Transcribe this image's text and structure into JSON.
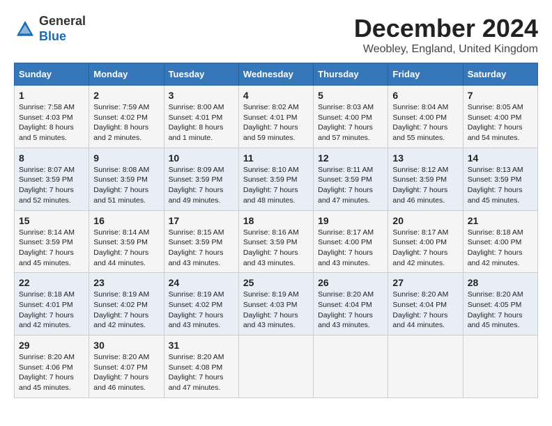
{
  "header": {
    "logo_general": "General",
    "logo_blue": "Blue",
    "title": "December 2024",
    "subtitle": "Weobley, England, United Kingdom"
  },
  "calendar": {
    "days_of_week": [
      "Sunday",
      "Monday",
      "Tuesday",
      "Wednesday",
      "Thursday",
      "Friday",
      "Saturday"
    ],
    "weeks": [
      [
        {
          "day": "1",
          "sunrise": "7:58 AM",
          "sunset": "4:03 PM",
          "daylight": "8 hours and 5 minutes."
        },
        {
          "day": "2",
          "sunrise": "7:59 AM",
          "sunset": "4:02 PM",
          "daylight": "8 hours and 2 minutes."
        },
        {
          "day": "3",
          "sunrise": "8:00 AM",
          "sunset": "4:01 PM",
          "daylight": "8 hours and 1 minute."
        },
        {
          "day": "4",
          "sunrise": "8:02 AM",
          "sunset": "4:01 PM",
          "daylight": "7 hours and 59 minutes."
        },
        {
          "day": "5",
          "sunrise": "8:03 AM",
          "sunset": "4:00 PM",
          "daylight": "7 hours and 57 minutes."
        },
        {
          "day": "6",
          "sunrise": "8:04 AM",
          "sunset": "4:00 PM",
          "daylight": "7 hours and 55 minutes."
        },
        {
          "day": "7",
          "sunrise": "8:05 AM",
          "sunset": "4:00 PM",
          "daylight": "7 hours and 54 minutes."
        }
      ],
      [
        {
          "day": "8",
          "sunrise": "8:07 AM",
          "sunset": "3:59 PM",
          "daylight": "7 hours and 52 minutes."
        },
        {
          "day": "9",
          "sunrise": "8:08 AM",
          "sunset": "3:59 PM",
          "daylight": "7 hours and 51 minutes."
        },
        {
          "day": "10",
          "sunrise": "8:09 AM",
          "sunset": "3:59 PM",
          "daylight": "7 hours and 49 minutes."
        },
        {
          "day": "11",
          "sunrise": "8:10 AM",
          "sunset": "3:59 PM",
          "daylight": "7 hours and 48 minutes."
        },
        {
          "day": "12",
          "sunrise": "8:11 AM",
          "sunset": "3:59 PM",
          "daylight": "7 hours and 47 minutes."
        },
        {
          "day": "13",
          "sunrise": "8:12 AM",
          "sunset": "3:59 PM",
          "daylight": "7 hours and 46 minutes."
        },
        {
          "day": "14",
          "sunrise": "8:13 AM",
          "sunset": "3:59 PM",
          "daylight": "7 hours and 45 minutes."
        }
      ],
      [
        {
          "day": "15",
          "sunrise": "8:14 AM",
          "sunset": "3:59 PM",
          "daylight": "7 hours and 45 minutes."
        },
        {
          "day": "16",
          "sunrise": "8:14 AM",
          "sunset": "3:59 PM",
          "daylight": "7 hours and 44 minutes."
        },
        {
          "day": "17",
          "sunrise": "8:15 AM",
          "sunset": "3:59 PM",
          "daylight": "7 hours and 43 minutes."
        },
        {
          "day": "18",
          "sunrise": "8:16 AM",
          "sunset": "3:59 PM",
          "daylight": "7 hours and 43 minutes."
        },
        {
          "day": "19",
          "sunrise": "8:17 AM",
          "sunset": "4:00 PM",
          "daylight": "7 hours and 43 minutes."
        },
        {
          "day": "20",
          "sunrise": "8:17 AM",
          "sunset": "4:00 PM",
          "daylight": "7 hours and 42 minutes."
        },
        {
          "day": "21",
          "sunrise": "8:18 AM",
          "sunset": "4:00 PM",
          "daylight": "7 hours and 42 minutes."
        }
      ],
      [
        {
          "day": "22",
          "sunrise": "8:18 AM",
          "sunset": "4:01 PM",
          "daylight": "7 hours and 42 minutes."
        },
        {
          "day": "23",
          "sunrise": "8:19 AM",
          "sunset": "4:02 PM",
          "daylight": "7 hours and 42 minutes."
        },
        {
          "day": "24",
          "sunrise": "8:19 AM",
          "sunset": "4:02 PM",
          "daylight": "7 hours and 43 minutes."
        },
        {
          "day": "25",
          "sunrise": "8:19 AM",
          "sunset": "4:03 PM",
          "daylight": "7 hours and 43 minutes."
        },
        {
          "day": "26",
          "sunrise": "8:20 AM",
          "sunset": "4:04 PM",
          "daylight": "7 hours and 43 minutes."
        },
        {
          "day": "27",
          "sunrise": "8:20 AM",
          "sunset": "4:04 PM",
          "daylight": "7 hours and 44 minutes."
        },
        {
          "day": "28",
          "sunrise": "8:20 AM",
          "sunset": "4:05 PM",
          "daylight": "7 hours and 45 minutes."
        }
      ],
      [
        {
          "day": "29",
          "sunrise": "8:20 AM",
          "sunset": "4:06 PM",
          "daylight": "7 hours and 45 minutes."
        },
        {
          "day": "30",
          "sunrise": "8:20 AM",
          "sunset": "4:07 PM",
          "daylight": "7 hours and 46 minutes."
        },
        {
          "day": "31",
          "sunrise": "8:20 AM",
          "sunset": "4:08 PM",
          "daylight": "7 hours and 47 minutes."
        },
        null,
        null,
        null,
        null
      ]
    ]
  }
}
